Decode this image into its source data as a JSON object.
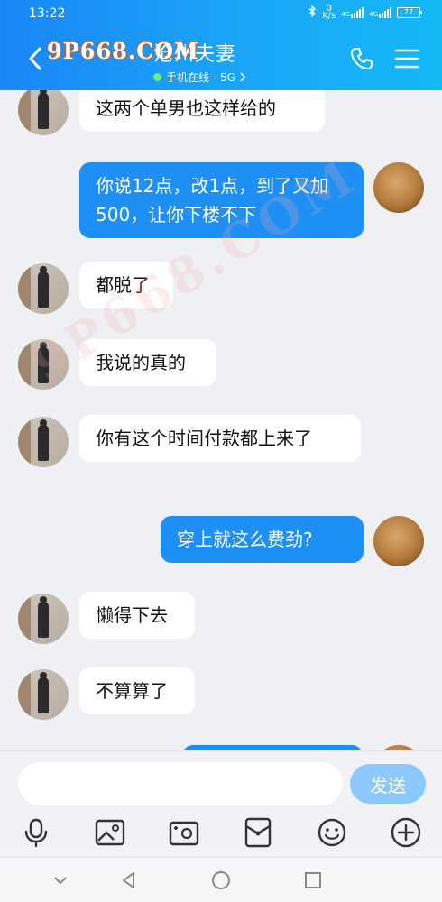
{
  "status_bar": {
    "time": "13:22",
    "speed_value": "0",
    "speed_unit": "K/s",
    "net1": "4G",
    "net2": "4G",
    "battery": "77"
  },
  "header": {
    "title": "沧州夫妻",
    "status": "手机在线 - 5G",
    "watermark": "9P668.COM"
  },
  "watermark_overlay": "9P668.COM",
  "messages": [
    {
      "side": "in",
      "text": "这两个单男也这样给的"
    },
    {
      "side": "out",
      "text": "你说12点，改1点，到了又加500，让你下楼不下"
    },
    {
      "side": "in",
      "text": "都脱了"
    },
    {
      "side": "in",
      "text": "我说的真的"
    },
    {
      "side": "in",
      "text": "你有这个时间付款都上来了"
    },
    {
      "side": "out",
      "text": "穿上就这么费劲?"
    },
    {
      "side": "in",
      "text": "懒得下去"
    },
    {
      "side": "in",
      "text": "不算算了"
    },
    {
      "side": "out",
      "text": ""
    }
  ],
  "composer": {
    "input_value": "",
    "send_label": "发送"
  },
  "toolbar_icons": [
    "microphone-icon",
    "image-icon",
    "camera-icon",
    "red-packet-icon",
    "emoji-icon",
    "plus-icon"
  ],
  "colors": {
    "header_start": "#1a86f8",
    "header_end": "#14b8f5",
    "bubble_out": "#1e8ff5",
    "bubble_in": "#ffffff",
    "send_button": "#8cc8fb",
    "background": "#eef0f3"
  }
}
